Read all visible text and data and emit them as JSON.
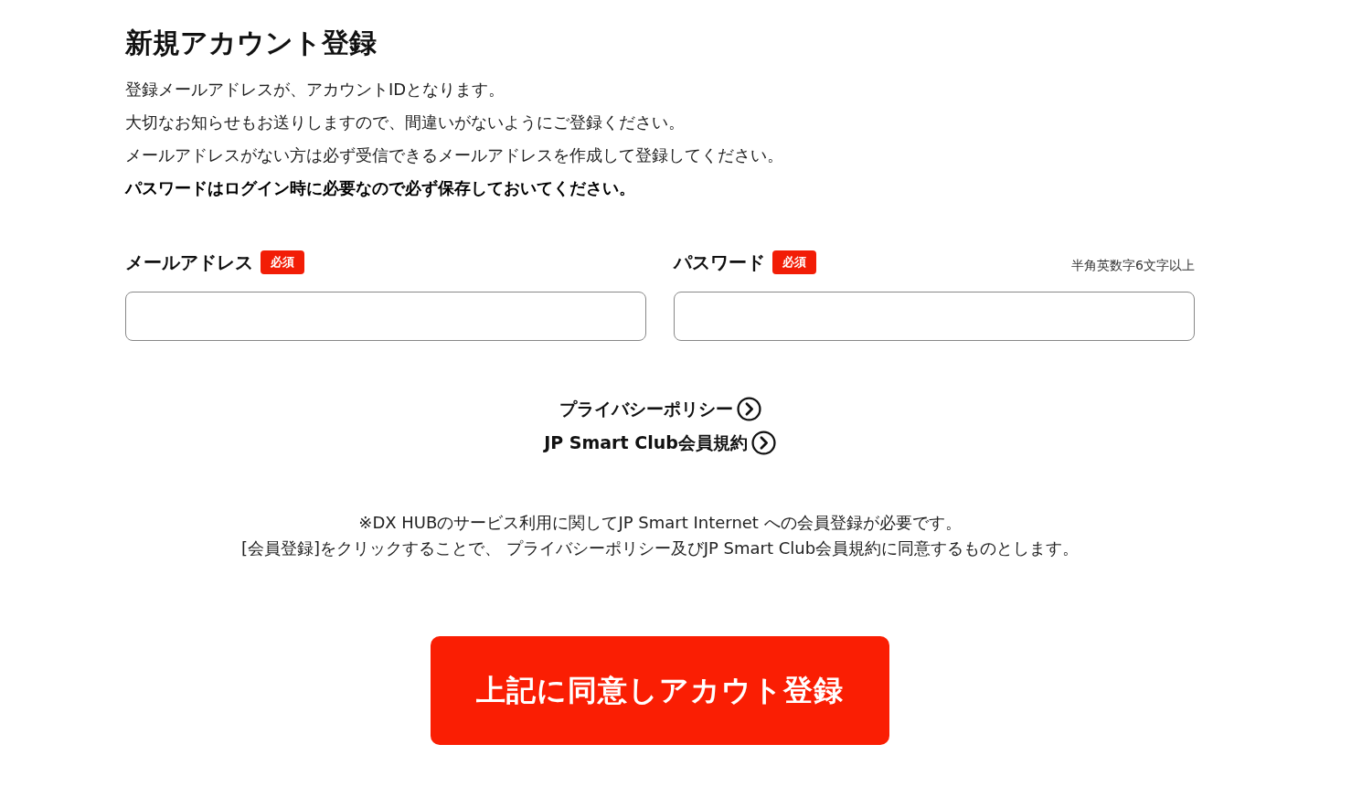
{
  "title": "新規アカウント登録",
  "intro": [
    {
      "text": "登録メールアドレスが、アカウントIDとなります。",
      "bold": false
    },
    {
      "text": "大切なお知らせもお送りしますので、間違いがないようにご登録ください。",
      "bold": false
    },
    {
      "text": "メールアドレスがない方は必ず受信できるメールアドレスを作成して登録してください。",
      "bold": false
    },
    {
      "text": "パスワードはログイン時に必要なので必ず保存しておいてください。",
      "bold": true
    }
  ],
  "fields": [
    {
      "label": "メールアドレス",
      "badge": "必須"
    },
    {
      "label": "パスワード",
      "badge": "必須",
      "hint": "半角英数字6文字以上"
    }
  ],
  "links": [
    {
      "text": "プライバシーポリシー"
    },
    {
      "text": "JP Smart Club会員規約"
    }
  ],
  "notes": [
    "※DX HUBのサービス利用に関してJP Smart Internet への会員登録が必要です。",
    "[会員登録]をクリックすることで、 プライバシーポリシー及びJP Smart Club会員規約に同意するものとします。"
  ],
  "submit_button": "上記に同意しアカウト登録"
}
